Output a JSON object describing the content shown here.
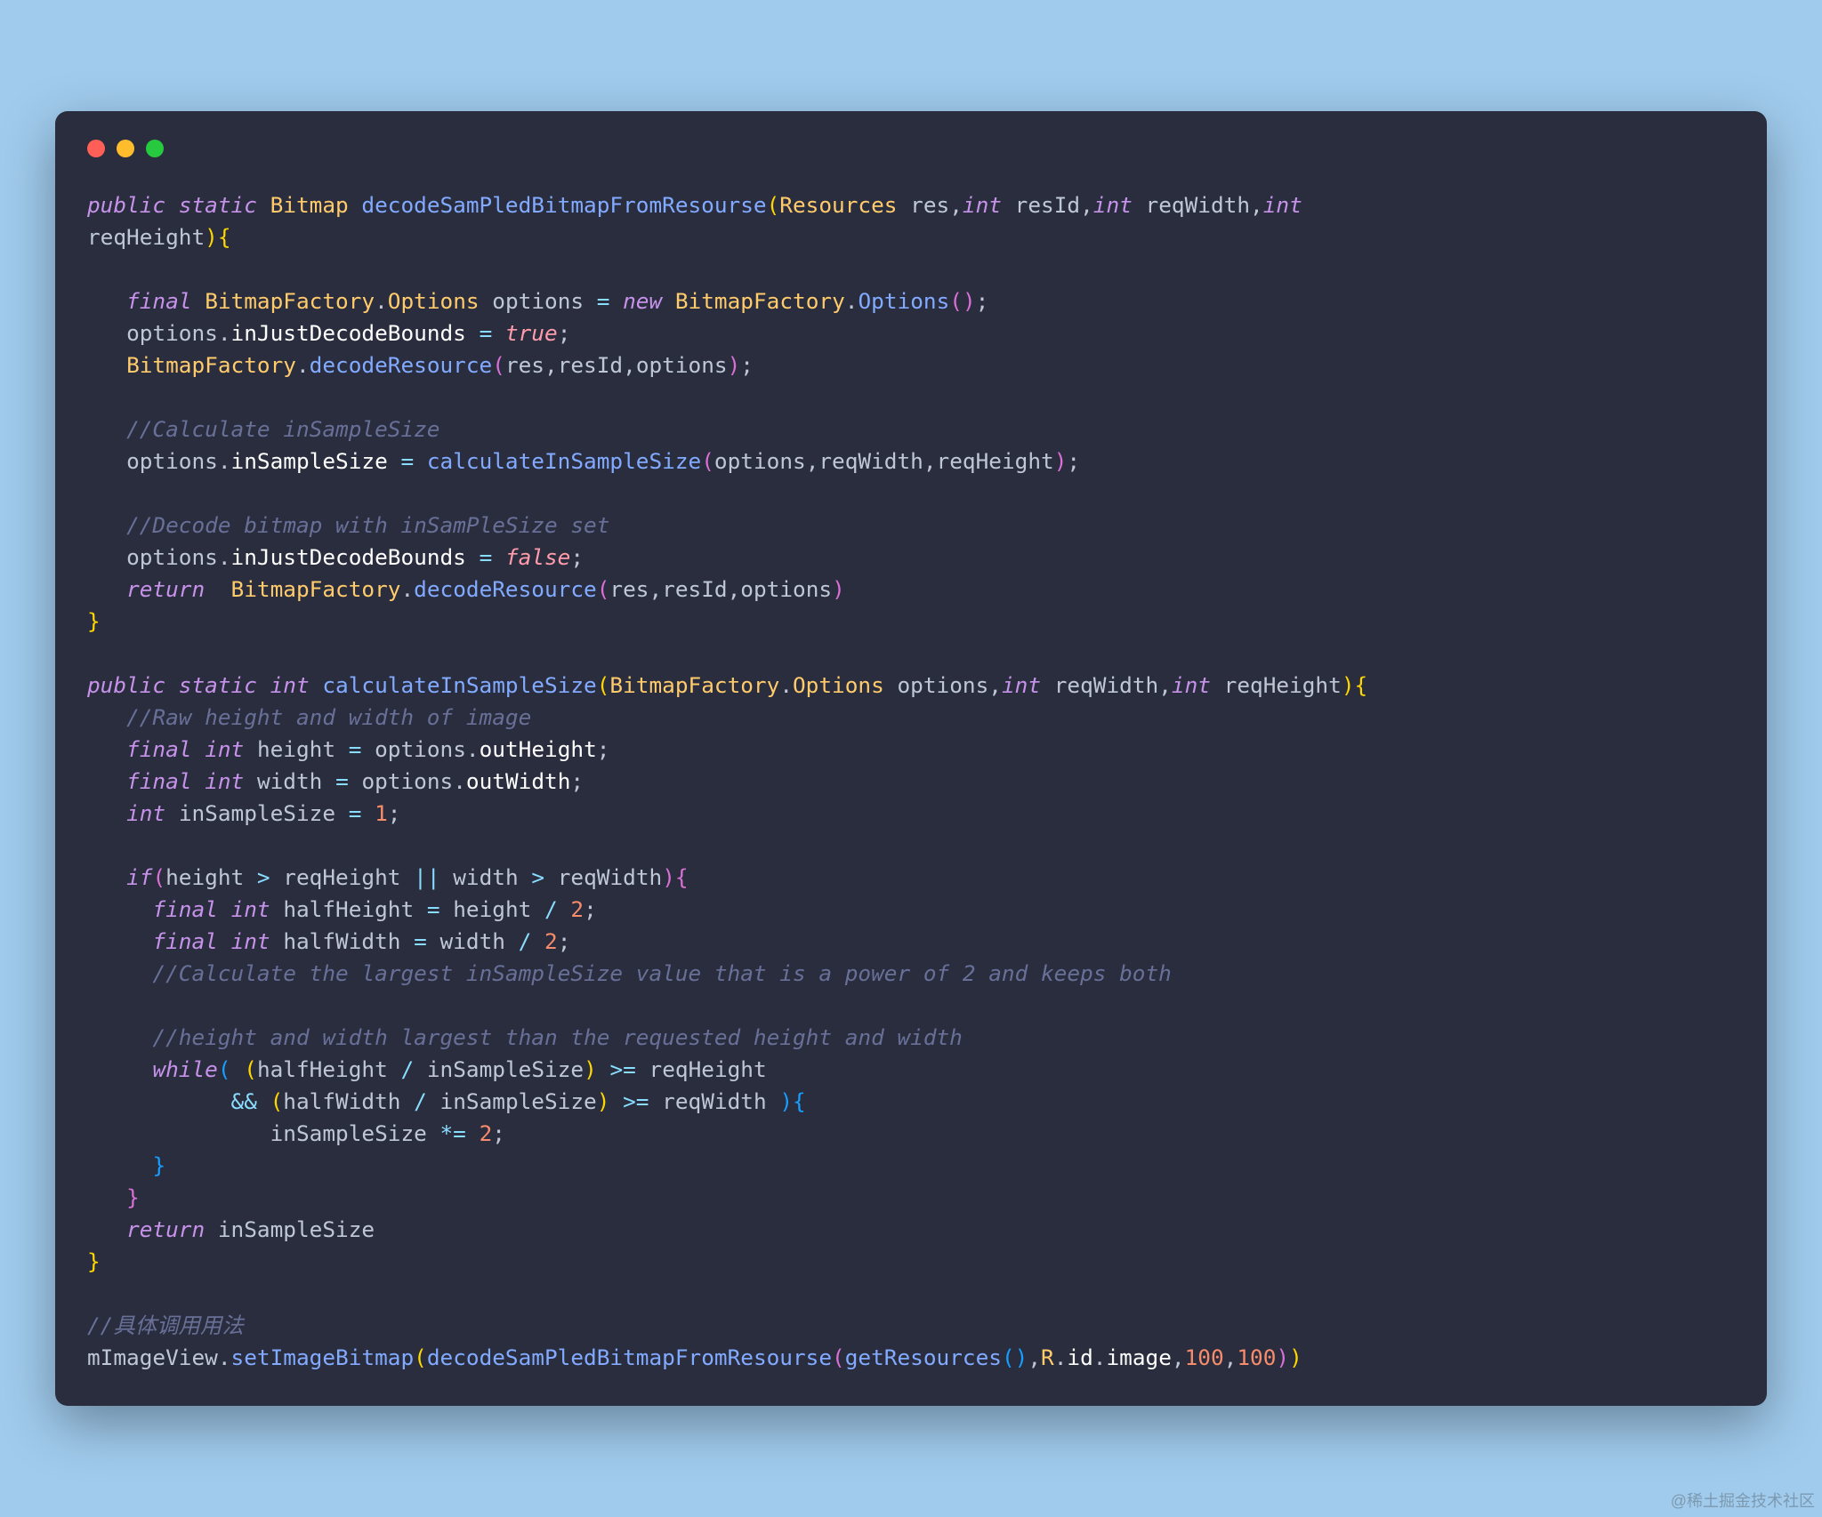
{
  "watermark": "@稀土掘金技术社区",
  "code_lines": [
    [
      {
        "c": "kw",
        "t": "public"
      },
      {
        "c": "pun",
        "t": " "
      },
      {
        "c": "kw",
        "t": "static"
      },
      {
        "c": "pun",
        "t": " "
      },
      {
        "c": "ty",
        "t": "Bitmap"
      },
      {
        "c": "pun",
        "t": " "
      },
      {
        "c": "fn",
        "t": "decodeSamPledBitmapFromResourse"
      },
      {
        "c": "br",
        "t": "("
      },
      {
        "c": "ty",
        "t": "Resources"
      },
      {
        "c": "pun",
        "t": " "
      },
      {
        "c": "id",
        "t": "res"
      },
      {
        "c": "pun",
        "t": ","
      },
      {
        "c": "kw",
        "t": "int"
      },
      {
        "c": "pun",
        "t": " "
      },
      {
        "c": "id",
        "t": "resId"
      },
      {
        "c": "pun",
        "t": ","
      },
      {
        "c": "kw",
        "t": "int"
      },
      {
        "c": "pun",
        "t": " "
      },
      {
        "c": "id",
        "t": "reqWidth"
      },
      {
        "c": "pun",
        "t": ","
      },
      {
        "c": "kw",
        "t": "int"
      },
      {
        "c": "pun",
        "t": " "
      }
    ],
    [
      {
        "c": "id",
        "t": "reqHeight"
      },
      {
        "c": "br",
        "t": ")"
      },
      {
        "c": "br",
        "t": "{"
      }
    ],
    [],
    [
      {
        "c": "pun",
        "t": "   "
      },
      {
        "c": "kw",
        "t": "final"
      },
      {
        "c": "pun",
        "t": " "
      },
      {
        "c": "ty",
        "t": "BitmapFactory"
      },
      {
        "c": "pun",
        "t": "."
      },
      {
        "c": "ty",
        "t": "Options"
      },
      {
        "c": "pun",
        "t": " "
      },
      {
        "c": "id",
        "t": "options"
      },
      {
        "c": "pun",
        "t": " "
      },
      {
        "c": "op",
        "t": "="
      },
      {
        "c": "pun",
        "t": " "
      },
      {
        "c": "kw",
        "t": "new"
      },
      {
        "c": "pun",
        "t": " "
      },
      {
        "c": "ty",
        "t": "BitmapFactory"
      },
      {
        "c": "pun",
        "t": "."
      },
      {
        "c": "fn",
        "t": "Options"
      },
      {
        "c": "br2",
        "t": "("
      },
      {
        "c": "br2",
        "t": ")"
      },
      {
        "c": "pun",
        "t": ";"
      }
    ],
    [
      {
        "c": "pun",
        "t": "   "
      },
      {
        "c": "id",
        "t": "options"
      },
      {
        "c": "pun",
        "t": "."
      },
      {
        "c": "fld",
        "t": "inJustDecodeBounds"
      },
      {
        "c": "pun",
        "t": " "
      },
      {
        "c": "op",
        "t": "="
      },
      {
        "c": "pun",
        "t": " "
      },
      {
        "c": "bool",
        "t": "true"
      },
      {
        "c": "pun",
        "t": ";"
      }
    ],
    [
      {
        "c": "pun",
        "t": "   "
      },
      {
        "c": "ty",
        "t": "BitmapFactory"
      },
      {
        "c": "pun",
        "t": "."
      },
      {
        "c": "mth",
        "t": "decodeResource"
      },
      {
        "c": "br2",
        "t": "("
      },
      {
        "c": "id",
        "t": "res"
      },
      {
        "c": "pun",
        "t": ","
      },
      {
        "c": "id",
        "t": "resId"
      },
      {
        "c": "pun",
        "t": ","
      },
      {
        "c": "id",
        "t": "options"
      },
      {
        "c": "br2",
        "t": ")"
      },
      {
        "c": "pun",
        "t": ";"
      }
    ],
    [],
    [
      {
        "c": "pun",
        "t": "   "
      },
      {
        "c": "cmt",
        "t": "//Calculate inSampleSize"
      }
    ],
    [
      {
        "c": "pun",
        "t": "   "
      },
      {
        "c": "id",
        "t": "options"
      },
      {
        "c": "pun",
        "t": "."
      },
      {
        "c": "fld",
        "t": "inSampleSize"
      },
      {
        "c": "pun",
        "t": " "
      },
      {
        "c": "op",
        "t": "="
      },
      {
        "c": "pun",
        "t": " "
      },
      {
        "c": "mth",
        "t": "calculateInSampleSize"
      },
      {
        "c": "br2",
        "t": "("
      },
      {
        "c": "id",
        "t": "options"
      },
      {
        "c": "pun",
        "t": ","
      },
      {
        "c": "id",
        "t": "reqWidth"
      },
      {
        "c": "pun",
        "t": ","
      },
      {
        "c": "id",
        "t": "reqHeight"
      },
      {
        "c": "br2",
        "t": ")"
      },
      {
        "c": "pun",
        "t": ";"
      }
    ],
    [],
    [
      {
        "c": "pun",
        "t": "   "
      },
      {
        "c": "cmt",
        "t": "//Decode bitmap with inSamPleSize set"
      }
    ],
    [
      {
        "c": "pun",
        "t": "   "
      },
      {
        "c": "id",
        "t": "options"
      },
      {
        "c": "pun",
        "t": "."
      },
      {
        "c": "fld",
        "t": "inJustDecodeBounds"
      },
      {
        "c": "pun",
        "t": " "
      },
      {
        "c": "op",
        "t": "="
      },
      {
        "c": "pun",
        "t": " "
      },
      {
        "c": "bool",
        "t": "false"
      },
      {
        "c": "pun",
        "t": ";"
      }
    ],
    [
      {
        "c": "pun",
        "t": "   "
      },
      {
        "c": "kw",
        "t": "return"
      },
      {
        "c": "pun",
        "t": "  "
      },
      {
        "c": "ty",
        "t": "BitmapFactory"
      },
      {
        "c": "pun",
        "t": "."
      },
      {
        "c": "mth",
        "t": "decodeResource"
      },
      {
        "c": "br2",
        "t": "("
      },
      {
        "c": "id",
        "t": "res"
      },
      {
        "c": "pun",
        "t": ","
      },
      {
        "c": "id",
        "t": "resId"
      },
      {
        "c": "pun",
        "t": ","
      },
      {
        "c": "id",
        "t": "options"
      },
      {
        "c": "br2",
        "t": ")"
      }
    ],
    [
      {
        "c": "br",
        "t": "}"
      }
    ],
    [],
    [
      {
        "c": "kw",
        "t": "public"
      },
      {
        "c": "pun",
        "t": " "
      },
      {
        "c": "kw",
        "t": "static"
      },
      {
        "c": "pun",
        "t": " "
      },
      {
        "c": "kw",
        "t": "int"
      },
      {
        "c": "pun",
        "t": " "
      },
      {
        "c": "fn",
        "t": "calculateInSampleSize"
      },
      {
        "c": "br",
        "t": "("
      },
      {
        "c": "ty",
        "t": "BitmapFactory"
      },
      {
        "c": "pun",
        "t": "."
      },
      {
        "c": "ty",
        "t": "Options"
      },
      {
        "c": "pun",
        "t": " "
      },
      {
        "c": "id",
        "t": "options"
      },
      {
        "c": "pun",
        "t": ","
      },
      {
        "c": "kw",
        "t": "int"
      },
      {
        "c": "pun",
        "t": " "
      },
      {
        "c": "id",
        "t": "reqWidth"
      },
      {
        "c": "pun",
        "t": ","
      },
      {
        "c": "kw",
        "t": "int"
      },
      {
        "c": "pun",
        "t": " "
      },
      {
        "c": "id",
        "t": "reqHeight"
      },
      {
        "c": "br",
        "t": ")"
      },
      {
        "c": "br",
        "t": "{"
      }
    ],
    [
      {
        "c": "pun",
        "t": "   "
      },
      {
        "c": "cmt",
        "t": "//Raw height and width of image"
      }
    ],
    [
      {
        "c": "pun",
        "t": "   "
      },
      {
        "c": "kw",
        "t": "final"
      },
      {
        "c": "pun",
        "t": " "
      },
      {
        "c": "kw",
        "t": "int"
      },
      {
        "c": "pun",
        "t": " "
      },
      {
        "c": "id",
        "t": "height"
      },
      {
        "c": "pun",
        "t": " "
      },
      {
        "c": "op",
        "t": "="
      },
      {
        "c": "pun",
        "t": " "
      },
      {
        "c": "id",
        "t": "options"
      },
      {
        "c": "pun",
        "t": "."
      },
      {
        "c": "fld",
        "t": "outHeight"
      },
      {
        "c": "pun",
        "t": ";"
      }
    ],
    [
      {
        "c": "pun",
        "t": "   "
      },
      {
        "c": "kw",
        "t": "final"
      },
      {
        "c": "pun",
        "t": " "
      },
      {
        "c": "kw",
        "t": "int"
      },
      {
        "c": "pun",
        "t": " "
      },
      {
        "c": "id",
        "t": "width"
      },
      {
        "c": "pun",
        "t": " "
      },
      {
        "c": "op",
        "t": "="
      },
      {
        "c": "pun",
        "t": " "
      },
      {
        "c": "id",
        "t": "options"
      },
      {
        "c": "pun",
        "t": "."
      },
      {
        "c": "fld",
        "t": "outWidth"
      },
      {
        "c": "pun",
        "t": ";"
      }
    ],
    [
      {
        "c": "pun",
        "t": "   "
      },
      {
        "c": "kw",
        "t": "int"
      },
      {
        "c": "pun",
        "t": " "
      },
      {
        "c": "id",
        "t": "inSampleSize"
      },
      {
        "c": "pun",
        "t": " "
      },
      {
        "c": "op",
        "t": "="
      },
      {
        "c": "pun",
        "t": " "
      },
      {
        "c": "num",
        "t": "1"
      },
      {
        "c": "pun",
        "t": ";"
      }
    ],
    [],
    [
      {
        "c": "pun",
        "t": "   "
      },
      {
        "c": "kw",
        "t": "if"
      },
      {
        "c": "br2",
        "t": "("
      },
      {
        "c": "id",
        "t": "height"
      },
      {
        "c": "pun",
        "t": " "
      },
      {
        "c": "op",
        "t": ">"
      },
      {
        "c": "pun",
        "t": " "
      },
      {
        "c": "id",
        "t": "reqHeight"
      },
      {
        "c": "pun",
        "t": " "
      },
      {
        "c": "op",
        "t": "||"
      },
      {
        "c": "pun",
        "t": " "
      },
      {
        "c": "id",
        "t": "width"
      },
      {
        "c": "pun",
        "t": " "
      },
      {
        "c": "op",
        "t": ">"
      },
      {
        "c": "pun",
        "t": " "
      },
      {
        "c": "id",
        "t": "reqWidth"
      },
      {
        "c": "br2",
        "t": ")"
      },
      {
        "c": "br2",
        "t": "{"
      }
    ],
    [
      {
        "c": "pun",
        "t": "     "
      },
      {
        "c": "kw",
        "t": "final"
      },
      {
        "c": "pun",
        "t": " "
      },
      {
        "c": "kw",
        "t": "int"
      },
      {
        "c": "pun",
        "t": " "
      },
      {
        "c": "id",
        "t": "halfHeight"
      },
      {
        "c": "pun",
        "t": " "
      },
      {
        "c": "op",
        "t": "="
      },
      {
        "c": "pun",
        "t": " "
      },
      {
        "c": "id",
        "t": "height"
      },
      {
        "c": "pun",
        "t": " "
      },
      {
        "c": "op",
        "t": "/"
      },
      {
        "c": "pun",
        "t": " "
      },
      {
        "c": "num",
        "t": "2"
      },
      {
        "c": "pun",
        "t": ";"
      }
    ],
    [
      {
        "c": "pun",
        "t": "     "
      },
      {
        "c": "kw",
        "t": "final"
      },
      {
        "c": "pun",
        "t": " "
      },
      {
        "c": "kw",
        "t": "int"
      },
      {
        "c": "pun",
        "t": " "
      },
      {
        "c": "id",
        "t": "halfWidth"
      },
      {
        "c": "pun",
        "t": " "
      },
      {
        "c": "op",
        "t": "="
      },
      {
        "c": "pun",
        "t": " "
      },
      {
        "c": "id",
        "t": "width"
      },
      {
        "c": "pun",
        "t": " "
      },
      {
        "c": "op",
        "t": "/"
      },
      {
        "c": "pun",
        "t": " "
      },
      {
        "c": "num",
        "t": "2"
      },
      {
        "c": "pun",
        "t": ";"
      }
    ],
    [
      {
        "c": "pun",
        "t": "     "
      },
      {
        "c": "cmt",
        "t": "//Calculate the largest inSampleSize value that is a power of 2 and keeps both"
      }
    ],
    [],
    [
      {
        "c": "pun",
        "t": "     "
      },
      {
        "c": "cmt",
        "t": "//height and width largest than the requested height and width"
      }
    ],
    [
      {
        "c": "pun",
        "t": "     "
      },
      {
        "c": "kw",
        "t": "while"
      },
      {
        "c": "br3",
        "t": "("
      },
      {
        "c": "pun",
        "t": " "
      },
      {
        "c": "br",
        "t": "("
      },
      {
        "c": "id",
        "t": "halfHeight"
      },
      {
        "c": "pun",
        "t": " "
      },
      {
        "c": "op",
        "t": "/"
      },
      {
        "c": "pun",
        "t": " "
      },
      {
        "c": "id",
        "t": "inSampleSize"
      },
      {
        "c": "br",
        "t": ")"
      },
      {
        "c": "pun",
        "t": " "
      },
      {
        "c": "op",
        "t": ">="
      },
      {
        "c": "pun",
        "t": " "
      },
      {
        "c": "id",
        "t": "reqHeight"
      }
    ],
    [
      {
        "c": "pun",
        "t": "           "
      },
      {
        "c": "op",
        "t": "&&"
      },
      {
        "c": "pun",
        "t": " "
      },
      {
        "c": "br",
        "t": "("
      },
      {
        "c": "id",
        "t": "halfWidth"
      },
      {
        "c": "pun",
        "t": " "
      },
      {
        "c": "op",
        "t": "/"
      },
      {
        "c": "pun",
        "t": " "
      },
      {
        "c": "id",
        "t": "inSampleSize"
      },
      {
        "c": "br",
        "t": ")"
      },
      {
        "c": "pun",
        "t": " "
      },
      {
        "c": "op",
        "t": ">="
      },
      {
        "c": "pun",
        "t": " "
      },
      {
        "c": "id",
        "t": "reqWidth"
      },
      {
        "c": "pun",
        "t": " "
      },
      {
        "c": "br3",
        "t": ")"
      },
      {
        "c": "br3",
        "t": "{"
      }
    ],
    [
      {
        "c": "pun",
        "t": "              "
      },
      {
        "c": "id",
        "t": "inSampleSize"
      },
      {
        "c": "pun",
        "t": " "
      },
      {
        "c": "op",
        "t": "*="
      },
      {
        "c": "pun",
        "t": " "
      },
      {
        "c": "num",
        "t": "2"
      },
      {
        "c": "pun",
        "t": ";"
      }
    ],
    [
      {
        "c": "pun",
        "t": "     "
      },
      {
        "c": "br3",
        "t": "}"
      }
    ],
    [
      {
        "c": "pun",
        "t": "   "
      },
      {
        "c": "br2",
        "t": "}"
      }
    ],
    [
      {
        "c": "pun",
        "t": "   "
      },
      {
        "c": "kw",
        "t": "return"
      },
      {
        "c": "pun",
        "t": " "
      },
      {
        "c": "id",
        "t": "inSampleSize"
      }
    ],
    [
      {
        "c": "br",
        "t": "}"
      }
    ],
    [],
    [
      {
        "c": "cmt",
        "t": "//具体调用用法"
      }
    ],
    [
      {
        "c": "id",
        "t": "mImageView"
      },
      {
        "c": "pun",
        "t": "."
      },
      {
        "c": "mth",
        "t": "setImageBitmap"
      },
      {
        "c": "br",
        "t": "("
      },
      {
        "c": "mth",
        "t": "decodeSamPledBitmapFromResourse"
      },
      {
        "c": "br2",
        "t": "("
      },
      {
        "c": "mth",
        "t": "getResources"
      },
      {
        "c": "br3",
        "t": "("
      },
      {
        "c": "br3",
        "t": ")"
      },
      {
        "c": "pun",
        "t": ","
      },
      {
        "c": "ty",
        "t": "R"
      },
      {
        "c": "pun",
        "t": "."
      },
      {
        "c": "fld",
        "t": "id"
      },
      {
        "c": "pun",
        "t": "."
      },
      {
        "c": "fld",
        "t": "image"
      },
      {
        "c": "pun",
        "t": ","
      },
      {
        "c": "num",
        "t": "100"
      },
      {
        "c": "pun",
        "t": ","
      },
      {
        "c": "num",
        "t": "100"
      },
      {
        "c": "br2",
        "t": ")"
      },
      {
        "c": "br",
        "t": ")"
      }
    ]
  ]
}
